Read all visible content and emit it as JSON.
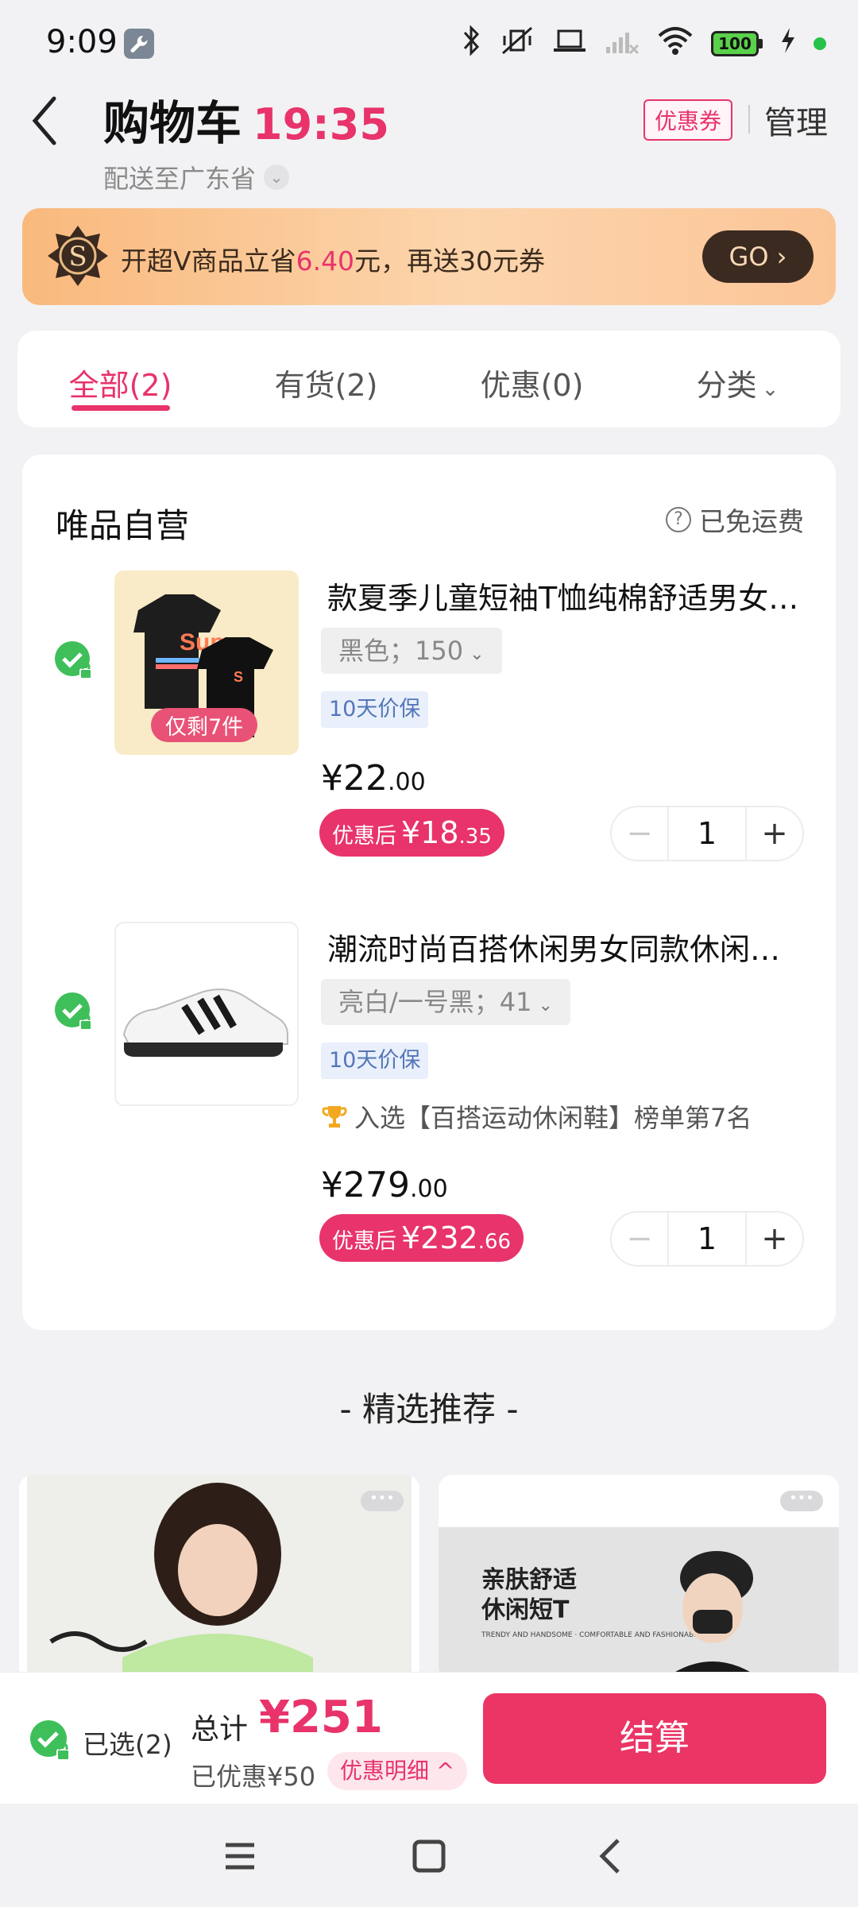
{
  "status_bar": {
    "time": "9:09",
    "battery": "100",
    "colors": {
      "charge_dot": "#26c24a",
      "battery_fill": "#5ad14a"
    }
  },
  "header": {
    "title": "购物车",
    "countdown": "19:35",
    "location": "配送至广东省",
    "coupon_label": "优惠券",
    "manage_label": "管理"
  },
  "vip_banner": {
    "badge_letter": "S",
    "text_before": "开超Ⅴ商品立省",
    "amount": "6.40",
    "text_after": "元，再送30元券",
    "go_label": "GO ›"
  },
  "tabs": [
    {
      "label": "全部(2)",
      "active": true
    },
    {
      "label": "有货(2)",
      "active": false
    },
    {
      "label": "优惠(0)",
      "active": false
    },
    {
      "label": "分类",
      "active": false,
      "has_caret": true
    }
  ],
  "store": {
    "name": "唯品自营",
    "shipping": "已免运费",
    "items": [
      {
        "name": "款夏季儿童短袖T恤纯棉舒适男女童体恤",
        "sku": "黑色；150",
        "stock_tag": "仅剩7件",
        "guarantee": "10天价保",
        "price_int": "¥22",
        "price_dec": ".00",
        "after_label": "优惠后",
        "after_int": "¥18",
        "after_dec": ".35",
        "quantity": "1",
        "thumb_text": "Super"
      },
      {
        "name": "潮流时尚百搭休闲男女同款休闲运动板鞋",
        "sku": "亮白/一号黑；41",
        "guarantee": "10天价保",
        "rank": "入选【百搭运动休闲鞋】榜单第7名",
        "price_int": "¥279",
        "price_dec": ".00",
        "after_label": "优惠后",
        "after_int": "¥232",
        "after_dec": ".66",
        "quantity": "1"
      }
    ]
  },
  "recommend": {
    "title": "- 精选推荐 -",
    "cards": [
      {
        "banner": ""
      },
      {
        "banner_line1": "亲肤舒适",
        "banner_line2": "休闲短T",
        "banner_sub": "TRENDY AND HANDSOME · COMFORTABLE AND FASHIONABLE TSHIRT"
      }
    ]
  },
  "bottom_bar": {
    "selected": "已选(2)",
    "total_label": "总计",
    "total_value": "¥251",
    "saved": "已优惠¥50",
    "detail_label": "优惠明细 ^",
    "checkout_label": "结算",
    "accent_color": "#e8336b"
  }
}
